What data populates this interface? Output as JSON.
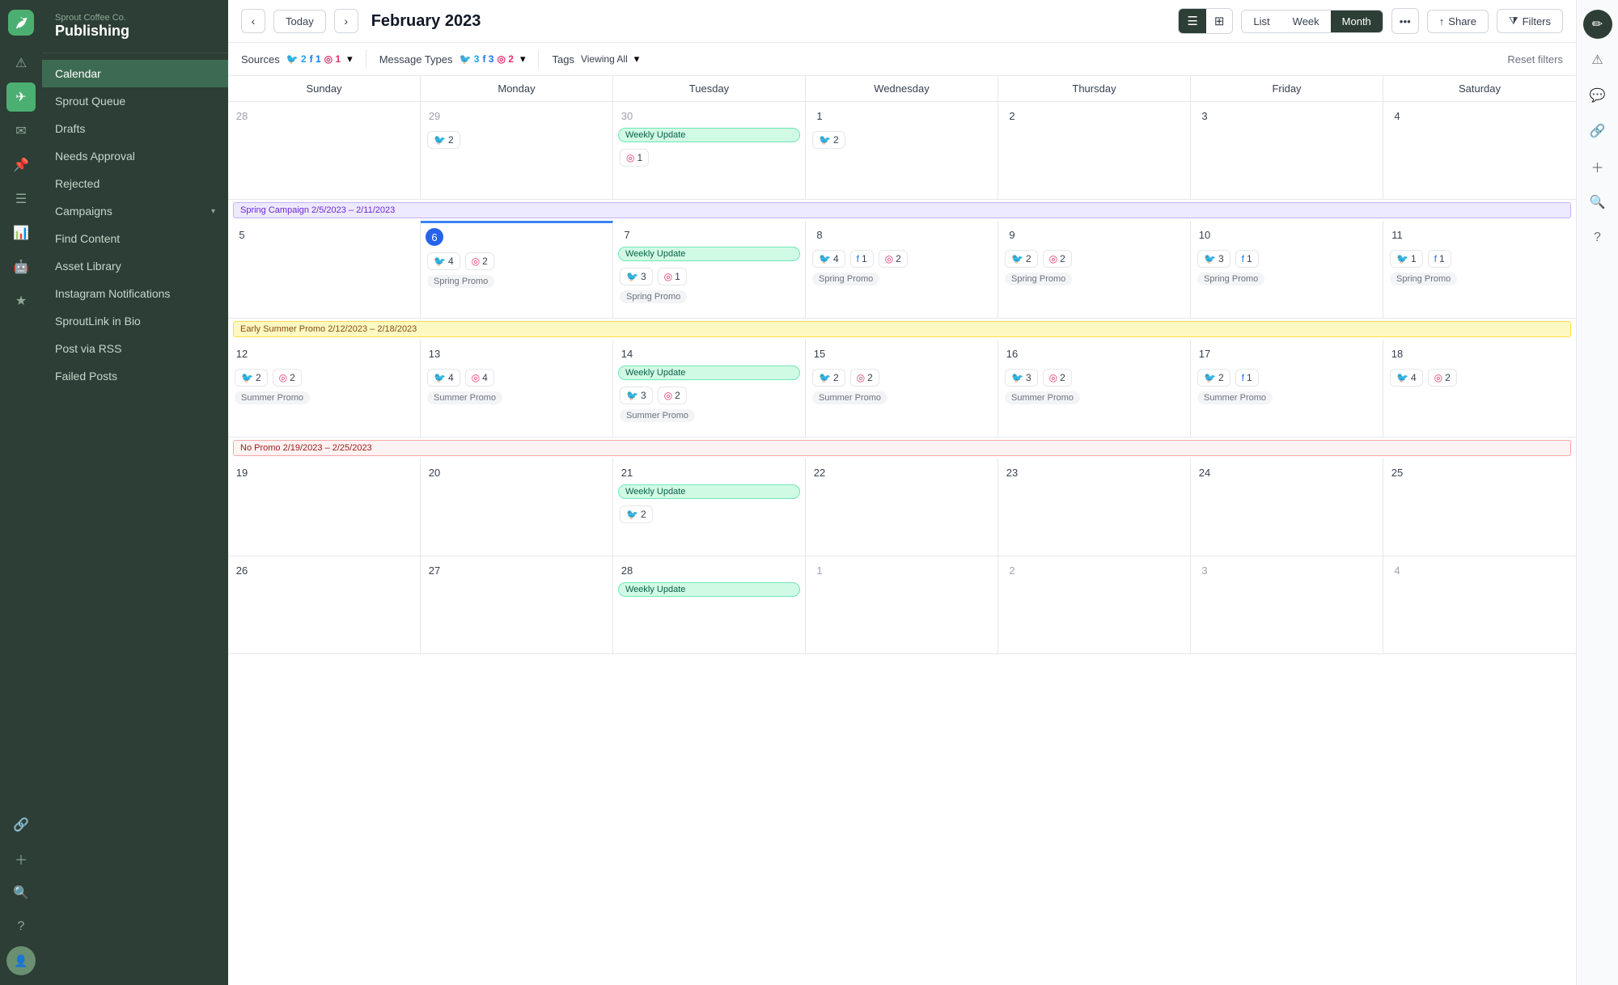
{
  "app": {
    "company": "Sprout Coffee Co.",
    "product": "Publishing"
  },
  "nav": {
    "items": [
      {
        "label": "Calendar",
        "active": true
      },
      {
        "label": "Sprout Queue",
        "active": false
      },
      {
        "label": "Drafts",
        "active": false
      },
      {
        "label": "Needs Approval",
        "active": false
      },
      {
        "label": "Rejected",
        "active": false
      },
      {
        "label": "Campaigns",
        "active": false,
        "hasChevron": true
      },
      {
        "label": "Find Content",
        "active": false
      },
      {
        "label": "Asset Library",
        "active": false
      },
      {
        "label": "Instagram Notifications",
        "active": false
      },
      {
        "label": "SproutLink in Bio",
        "active": false
      },
      {
        "label": "Post via RSS",
        "active": false
      },
      {
        "label": "Failed Posts",
        "active": false
      }
    ]
  },
  "topbar": {
    "month_title": "February 2023",
    "today_label": "Today",
    "view_compact": "≡",
    "view_expand": "⊞",
    "list_btn": "List",
    "week_btn": "Week",
    "month_btn": "Month",
    "more_label": "•••",
    "share_label": "Share",
    "filters_label": "Filters"
  },
  "filterbar": {
    "sources_label": "Sources",
    "sources": {
      "tw": 2,
      "fb": 1,
      "ig": 1
    },
    "message_types_label": "Message Types",
    "message_types": {
      "tw": 3,
      "fb": 3,
      "ig": 2
    },
    "tags_label": "Tags",
    "tags_value": "Viewing All",
    "reset_label": "Reset filters"
  },
  "calendar": {
    "day_headers": [
      "Sunday",
      "Monday",
      "Tuesday",
      "Wednesday",
      "Thursday",
      "Friday",
      "Saturday"
    ],
    "weeks": [
      {
        "campaign": null,
        "days": [
          {
            "num": "28",
            "other": true,
            "today": false,
            "events": [],
            "posts": [],
            "promo": null
          },
          {
            "num": "29",
            "other": true,
            "today": false,
            "events": [],
            "posts": [
              {
                "icon": "tw",
                "count": 2
              }
            ],
            "promo": null
          },
          {
            "num": "30",
            "other": true,
            "today": false,
            "events": [
              {
                "label": "Weekly Update",
                "color": "green"
              }
            ],
            "posts": [
              {
                "icon": "ig",
                "count": 1
              }
            ],
            "promo": null
          },
          {
            "num": "1",
            "other": false,
            "today": false,
            "events": [],
            "posts": [
              {
                "icon": "tw",
                "count": 2
              }
            ],
            "promo": null
          },
          {
            "num": "2",
            "other": false,
            "today": false,
            "events": [],
            "posts": [],
            "promo": null
          },
          {
            "num": "3",
            "other": false,
            "today": false,
            "events": [],
            "posts": [],
            "promo": null
          },
          {
            "num": "4",
            "other": false,
            "today": false,
            "events": [],
            "posts": [],
            "promo": null
          }
        ]
      },
      {
        "campaign": {
          "label": "Spring Campaign 2/5/2023 – 2/11/2023",
          "type": "spring"
        },
        "days": [
          {
            "num": "5",
            "other": false,
            "today": false,
            "events": [],
            "posts": [],
            "promo": null
          },
          {
            "num": "6",
            "other": false,
            "today": true,
            "events": [],
            "posts": [
              {
                "icon": "tw",
                "count": 4
              },
              {
                "icon": "ig",
                "count": 2
              }
            ],
            "promo": "Spring Promo"
          },
          {
            "num": "7",
            "other": false,
            "today": false,
            "events": [
              {
                "label": "Weekly Update",
                "color": "green"
              }
            ],
            "posts": [
              {
                "icon": "tw",
                "count": 3
              },
              {
                "icon": "ig",
                "count": 1
              }
            ],
            "promo": "Spring Promo"
          },
          {
            "num": "8",
            "other": false,
            "today": false,
            "events": [],
            "posts": [
              {
                "icon": "tw",
                "count": 4
              },
              {
                "icon": "fb",
                "count": 1
              },
              {
                "icon": "ig",
                "count": 2
              }
            ],
            "promo": "Spring Promo"
          },
          {
            "num": "9",
            "other": false,
            "today": false,
            "events": [],
            "posts": [
              {
                "icon": "tw",
                "count": 2
              },
              {
                "icon": "ig",
                "count": 2
              }
            ],
            "promo": "Spring Promo"
          },
          {
            "num": "10",
            "other": false,
            "today": false,
            "events": [],
            "posts": [
              {
                "icon": "tw",
                "count": 3
              },
              {
                "icon": "fb",
                "count": 1
              }
            ],
            "promo": "Spring Promo"
          },
          {
            "num": "11",
            "other": false,
            "today": false,
            "events": [],
            "posts": [
              {
                "icon": "tw",
                "count": 1
              },
              {
                "icon": "fb",
                "count": 1
              }
            ],
            "promo": "Spring Promo"
          }
        ]
      },
      {
        "campaign": {
          "label": "Early Summer Promo 2/12/2023 – 2/18/2023",
          "type": "summer"
        },
        "days": [
          {
            "num": "12",
            "other": false,
            "today": false,
            "events": [],
            "posts": [
              {
                "icon": "tw",
                "count": 2
              },
              {
                "icon": "ig",
                "count": 2
              }
            ],
            "promo": "Summer Promo"
          },
          {
            "num": "13",
            "other": false,
            "today": false,
            "events": [],
            "posts": [
              {
                "icon": "tw",
                "count": 4
              },
              {
                "icon": "ig",
                "count": 4
              }
            ],
            "promo": "Summer Promo"
          },
          {
            "num": "14",
            "other": false,
            "today": false,
            "events": [
              {
                "label": "Weekly Update",
                "color": "green"
              }
            ],
            "posts": [
              {
                "icon": "tw",
                "count": 3
              },
              {
                "icon": "ig",
                "count": 2
              }
            ],
            "promo": "Summer Promo"
          },
          {
            "num": "15",
            "other": false,
            "today": false,
            "events": [],
            "posts": [
              {
                "icon": "tw",
                "count": 2
              },
              {
                "icon": "ig",
                "count": 2
              }
            ],
            "promo": "Summer Promo"
          },
          {
            "num": "16",
            "other": false,
            "today": false,
            "events": [],
            "posts": [
              {
                "icon": "tw",
                "count": 3
              },
              {
                "icon": "ig",
                "count": 2
              }
            ],
            "promo": "Summer Promo"
          },
          {
            "num": "17",
            "other": false,
            "today": false,
            "events": [],
            "posts": [
              {
                "icon": "tw",
                "count": 2
              },
              {
                "icon": "fb",
                "count": 1
              }
            ],
            "promo": "Summer Promo"
          },
          {
            "num": "18",
            "other": false,
            "today": false,
            "events": [],
            "posts": [
              {
                "icon": "tw",
                "count": 4
              },
              {
                "icon": "ig",
                "count": 2
              }
            ],
            "promo": null
          }
        ]
      },
      {
        "campaign": {
          "label": "No Promo 2/19/2023 – 2/25/2023",
          "type": "no-promo"
        },
        "days": [
          {
            "num": "19",
            "other": false,
            "today": false,
            "events": [],
            "posts": [],
            "promo": null
          },
          {
            "num": "20",
            "other": false,
            "today": false,
            "events": [],
            "posts": [],
            "promo": null
          },
          {
            "num": "21",
            "other": false,
            "today": false,
            "events": [
              {
                "label": "Weekly Update",
                "color": "green"
              }
            ],
            "posts": [
              {
                "icon": "tw",
                "count": 2
              }
            ],
            "promo": null
          },
          {
            "num": "22",
            "other": false,
            "today": false,
            "events": [],
            "posts": [],
            "promo": null
          },
          {
            "num": "23",
            "other": false,
            "today": false,
            "events": [],
            "posts": [],
            "promo": null
          },
          {
            "num": "24",
            "other": false,
            "today": false,
            "events": [],
            "posts": [],
            "promo": null
          },
          {
            "num": "25",
            "other": false,
            "today": false,
            "events": [],
            "posts": [],
            "promo": null
          }
        ]
      },
      {
        "campaign": null,
        "days": [
          {
            "num": "26",
            "other": false,
            "today": false,
            "events": [],
            "posts": [],
            "promo": null
          },
          {
            "num": "27",
            "other": false,
            "today": false,
            "events": [],
            "posts": [],
            "promo": null
          },
          {
            "num": "28",
            "other": false,
            "today": false,
            "events": [
              {
                "label": "Weekly Update",
                "color": "green"
              }
            ],
            "posts": [],
            "promo": null
          },
          {
            "num": "1",
            "other": true,
            "today": false,
            "events": [],
            "posts": [],
            "promo": null
          },
          {
            "num": "2",
            "other": true,
            "today": false,
            "events": [],
            "posts": [],
            "promo": null
          },
          {
            "num": "3",
            "other": true,
            "today": false,
            "events": [],
            "posts": [],
            "promo": null
          },
          {
            "num": "4",
            "other": true,
            "today": false,
            "events": [],
            "posts": [],
            "promo": null
          }
        ]
      }
    ]
  }
}
